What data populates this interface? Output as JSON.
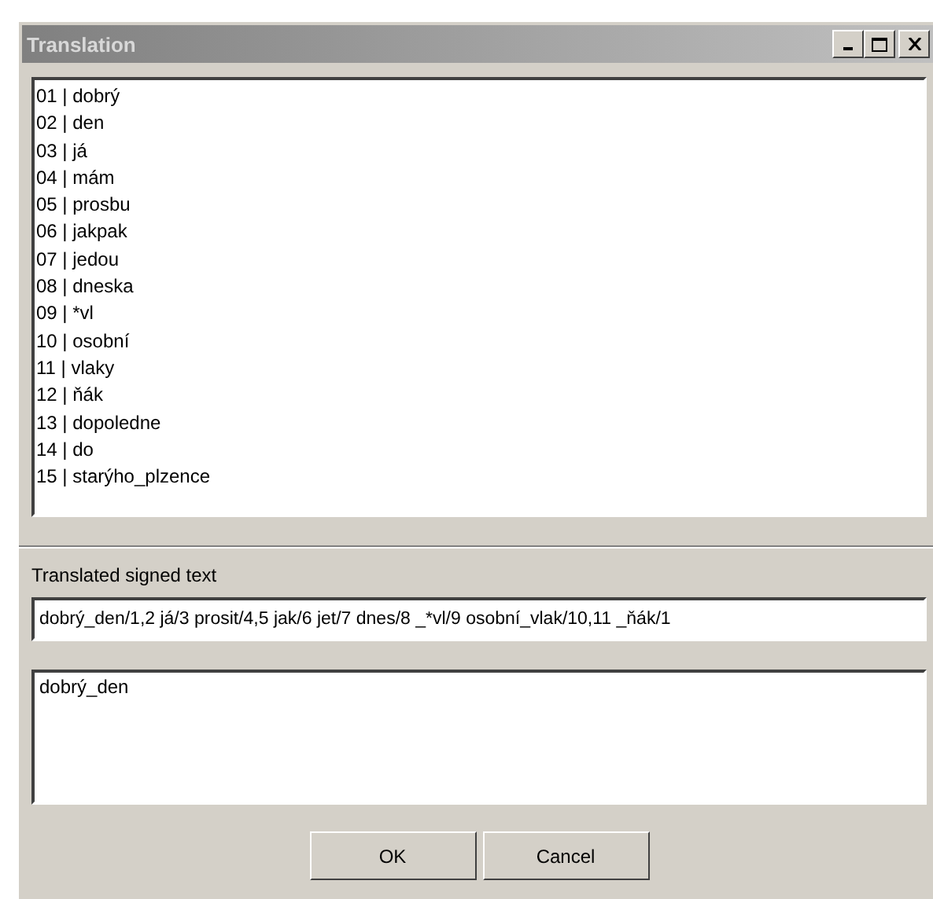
{
  "window": {
    "title": "Translation"
  },
  "word_list": [
    "01 | dobrý",
    "02 | den",
    "03 | já",
    "04 | mám",
    "05 | prosbu",
    "06 | jakpak",
    "07 | jedou",
    "08 | dneska",
    "09 | *vl",
    "10 | osobní",
    "11 | vlaky",
    "12 | ňák",
    "13 | dopoledne",
    "14 | do",
    "15 | starýho_plzence"
  ],
  "signed_text": {
    "label": "Translated signed text",
    "value": "dobrý_den/1,2 já/3 prosit/4,5 jak/6 jet/7 dnes/8 _*vl/9 osobní_vlak/10,11 _ňák/1"
  },
  "output_text": "dobrý_den",
  "buttons": [
    "OK",
    "Cancel"
  ]
}
